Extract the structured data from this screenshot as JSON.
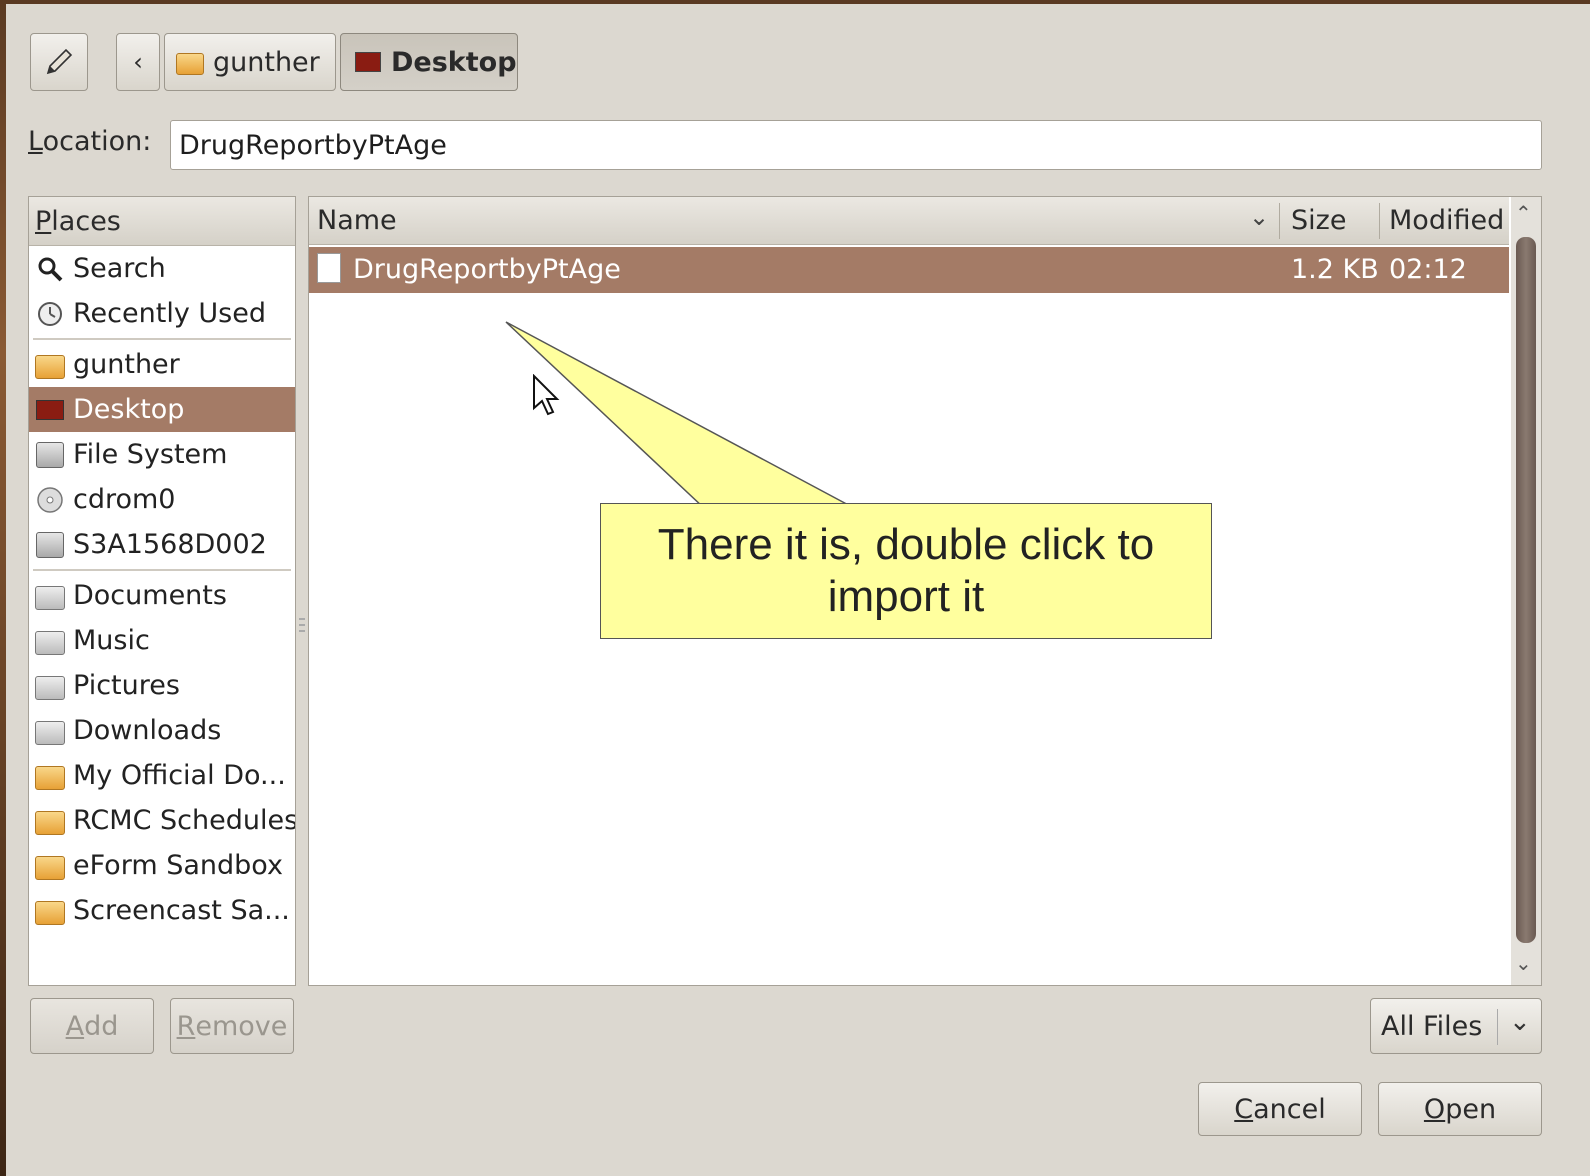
{
  "toolbar": {
    "edit_icon": "pencil-icon",
    "back_icon": "chevron-left-icon",
    "path": [
      {
        "label": "gunther",
        "icon": "home-folder-icon"
      },
      {
        "label": "Desktop",
        "icon": "desktop-icon"
      }
    ]
  },
  "location": {
    "label_prefix": "L",
    "label_rest": "ocation:",
    "value": "DrugReportbyPtAge"
  },
  "places": {
    "header_prefix": "P",
    "header_rest": "laces",
    "items": [
      {
        "label": "Search",
        "icon": "search-icon"
      },
      {
        "label": "Recently Used",
        "icon": "recent-icon"
      },
      {
        "label": "gunther",
        "icon": "home-folder-icon"
      },
      {
        "label": "Desktop",
        "icon": "desktop-icon",
        "selected": true
      },
      {
        "label": "File System",
        "icon": "harddisk-icon"
      },
      {
        "label": "cdrom0",
        "icon": "cdrom-icon"
      },
      {
        "label": "S3A1568D002",
        "icon": "harddisk-icon"
      },
      {
        "label": "Documents",
        "icon": "documents-folder-icon"
      },
      {
        "label": "Music",
        "icon": "music-folder-icon"
      },
      {
        "label": "Pictures",
        "icon": "pictures-folder-icon"
      },
      {
        "label": "Downloads",
        "icon": "downloads-folder-icon"
      },
      {
        "label": "My Official Do...",
        "icon": "folder-icon"
      },
      {
        "label": "RCMC Schedules",
        "icon": "folder-icon"
      },
      {
        "label": "eForm Sandbox",
        "icon": "folder-icon"
      },
      {
        "label": "Screencast Sa...",
        "icon": "folder-icon"
      }
    ],
    "add_prefix": "A",
    "add_rest": "dd",
    "remove_prefix": "R",
    "remove_rest": "emove"
  },
  "files": {
    "columns": {
      "name": "Name",
      "size": "Size",
      "modified": "Modified"
    },
    "rows": [
      {
        "name": "DrugReportbyPtAge",
        "size": "1.2 KB",
        "modified": "02:12",
        "icon": "document-icon",
        "selected": true
      }
    ]
  },
  "filter": {
    "selected": "All Files"
  },
  "buttons": {
    "cancel_prefix": "C",
    "cancel_rest": "ancel",
    "open_prefix": "O",
    "open_rest": "pen"
  },
  "callout": {
    "text": "There it is, double click to import it"
  },
  "colors": {
    "selection": "#a47b66",
    "callout": "#ffff9e",
    "dialog_bg": "#dcd8d0"
  }
}
